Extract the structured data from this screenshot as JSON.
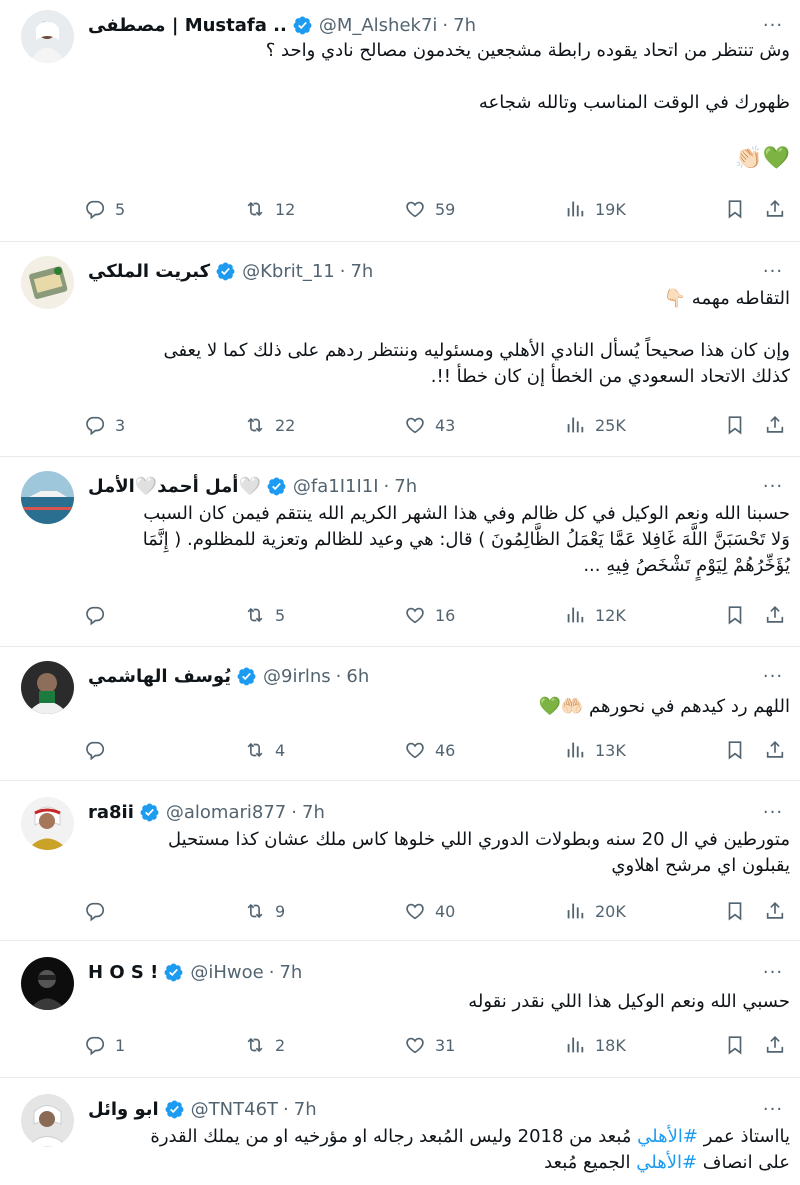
{
  "tweets": [
    {
      "name": "مصطفى | Mustafa ..",
      "handle": "@M_Alshek7i",
      "time": "7h",
      "lines": [
        "وش تنتظر من اتحاد يقوده رابطة مشجعين يخدمون مصالح نادي واحد ؟",
        "",
        "ظهورك في الوقت المناسب وتالله شجاعه",
        "",
        "💚👏🏻"
      ],
      "replies": "5",
      "reposts": "12",
      "likes": "59",
      "views": "19K"
    },
    {
      "name": "كبريت الملكي",
      "handle": "@Kbrit_11",
      "time": "7h",
      "lines": [
        "التقاطه مهمه 👇🏻",
        "",
        "وإن كان هذا صحيحاً يُسأل النادي الأهلي ومسئوليه وننتظر ردهم على ذلك كما لا يعفى",
        "كذلك الاتحاد السعودي من الخطأ إن كان خطأ !!."
      ],
      "replies": "3",
      "reposts": "22",
      "likes": "43",
      "views": "25K"
    },
    {
      "name": "أمل أحمد🤍الأمل🤍",
      "handle": "@fa1I1I1I",
      "time": "7h",
      "lines": [
        "حسبنا الله ونعم الوكيل في  كل ظالم وفي هذا الشهر الكريم الله ينتقم فيمن كان السبب",
        "وَلا تَحْسَبَنَّ اللَّهَ غَافِلا عَمَّا يَعْمَلُ الظَّالِمُونَ ) قال: هي وعيد للظالم وتعزية للمظلوم. ( إِنَّمَا",
        "يُؤَخِّرُهُمْ لِيَوْمٍ تَشْخَصُ فِيهِ ..."
      ],
      "replies": "",
      "reposts": "5",
      "likes": "16",
      "views": "12K"
    },
    {
      "name": "يُوسف الهاشمي",
      "handle": "@9irlns",
      "time": "6h",
      "lines": [
        "اللهم رد كيدهم في نحورهم 🤲🏻💚"
      ],
      "replies": "",
      "reposts": "4",
      "likes": "46",
      "views": "13K"
    },
    {
      "name": "ra8ii",
      "handle": "@alomari877",
      "time": "7h",
      "lines": [
        "متورطين في ال 20 سنه وبطولات الدوري اللي خلوها كاس ملك عشان كذا مستحيل",
        "يقبلون اي مرشح اهلاوي"
      ],
      "replies": "",
      "reposts": "9",
      "likes": "40",
      "views": "20K"
    },
    {
      "name": "H O S !",
      "handle": "@iHwoe",
      "time": "7h",
      "lines": [
        "حسبي الله ونعم الوكيل هذا اللي نقدر نقوله"
      ],
      "replies": "1",
      "reposts": "2",
      "likes": "31",
      "views": "18K"
    },
    {
      "name": "ابو وائل",
      "handle": "@TNT46T",
      "time": "7h",
      "line1_pre": "يااستاذ عمر ",
      "line1_tag": "#الأهلي",
      "line1_post": " مُبعد من 2018 وليس المُبعد رجاله او مؤرخيه او من يملك القدرة",
      "line2_pre": "على انصاف ",
      "line2_tag": "#الأهلي",
      "line2_post": " الجميع مُبعد",
      "replies": "",
      "reposts": "",
      "likes": "",
      "views": ""
    }
  ],
  "icons": {
    "reply": "reply-icon",
    "repost": "repost-icon",
    "like": "like-icon",
    "views": "views-icon",
    "bookmark": "bookmark-icon",
    "share": "share-icon",
    "verified": "verified-badge-icon",
    "more": "more-options-icon"
  },
  "colors": {
    "accent": "#1d9bf0",
    "text": "#0f1419",
    "muted": "#536471",
    "divider": "#e7e9ea"
  },
  "more_glyph": "···"
}
